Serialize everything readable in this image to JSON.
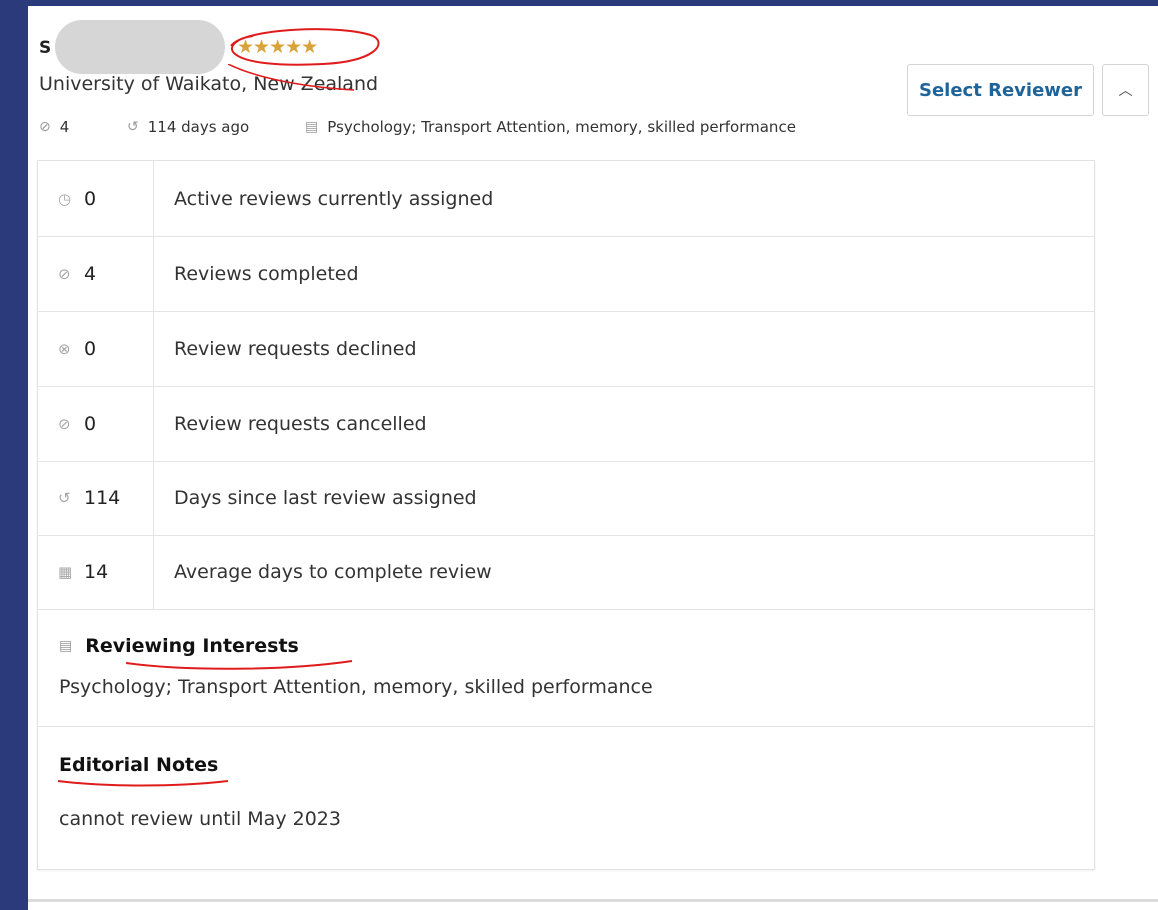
{
  "reviewer": {
    "name_initial": "S",
    "rating_stars": "★★★★★",
    "rating_value": 5,
    "rating_max": 5,
    "affiliation": "University of Waikato, New Zealand"
  },
  "meta": {
    "completed_count": "4",
    "last_assigned": "114 days ago",
    "interests_short": "Psychology; Transport Attention, memory, skilled performance"
  },
  "actions": {
    "select_reviewer": "Select Reviewer",
    "collapse_icon": "chevron-up-icon"
  },
  "stats": [
    {
      "value": "0",
      "label": "Active reviews currently assigned",
      "icon": "clock-icon"
    },
    {
      "value": "4",
      "label": "Reviews completed",
      "icon": "check-circle-icon"
    },
    {
      "value": "0",
      "label": "Review requests declined",
      "icon": "x-circle-icon"
    },
    {
      "value": "0",
      "label": "Review requests cancelled",
      "icon": "ban-icon"
    },
    {
      "value": "114",
      "label": "Days since last review assigned",
      "icon": "history-icon"
    },
    {
      "value": "14",
      "label": "Average days to complete review",
      "icon": "calendar-icon"
    }
  ],
  "interests": {
    "heading": "Reviewing Interests",
    "text": "Psychology; Transport Attention, memory, skilled performance"
  },
  "notes": {
    "heading": "Editorial Notes",
    "text": "cannot review until May 2023"
  },
  "colors": {
    "accent": "#1e6399",
    "stars": "#d8a33a",
    "annotation": "#e01b1b",
    "frame": "#2a3a7a"
  }
}
